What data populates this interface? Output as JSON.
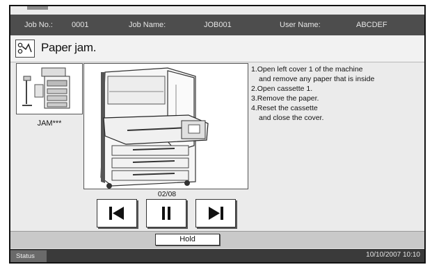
{
  "header": {
    "job_no_label": "Job No.:",
    "job_no_value": "0001",
    "job_name_label": "Job Name:",
    "job_name_value": "JOB001",
    "user_name_label": "User Name:",
    "user_name_value": "ABCDEF"
  },
  "title": {
    "icon": "paper-jam-icon",
    "text": "Paper jam."
  },
  "thumbnail": {
    "label": "JAM***"
  },
  "instructions": [
    "1.Open left cover 1 of the machine",
    "and remove any paper that is inside",
    "2.Open cassette 1.",
    "3.Remove the paper.",
    "4.Reset the cassette",
    "and close the cover."
  ],
  "pager": {
    "text": "02/08"
  },
  "controls": {
    "prev_icon": "skip-back-icon",
    "pause_icon": "pause-icon",
    "next_icon": "skip-forward-icon",
    "hold_label": "Hold"
  },
  "status_bar": {
    "status_label": "Status",
    "datetime": "10/10/2007  10:10"
  }
}
